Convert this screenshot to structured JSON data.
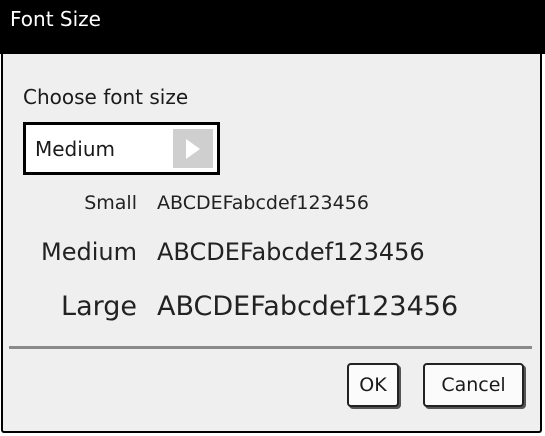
{
  "dialog": {
    "title": "Font Size",
    "prompt": "Choose font size",
    "selector": {
      "value": "Medium",
      "arrow_icon": "triangle-right-icon"
    },
    "samples": [
      {
        "label": "Small",
        "text": "ABCDEFabcdef123456"
      },
      {
        "label": "Medium",
        "text": "ABCDEFabcdef123456"
      },
      {
        "label": "Large",
        "text": "ABCDEFabcdef123456"
      }
    ],
    "buttons": {
      "ok_label": "OK",
      "cancel_label": "Cancel"
    }
  },
  "colors": {
    "titlebar": "#000000",
    "dialog_background": "#efefef",
    "selector_arrow": "#cfcfcf",
    "divider": "#8a8a8a"
  }
}
